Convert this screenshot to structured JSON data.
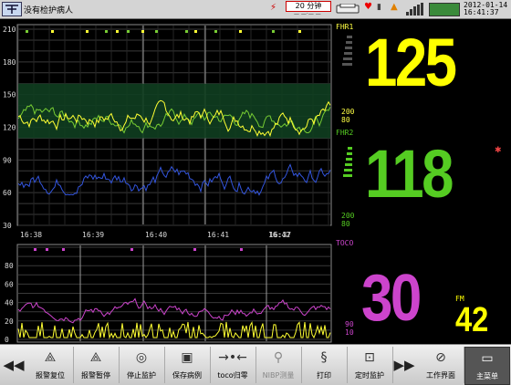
{
  "title_bar": {
    "patient_label": "没有检护病人",
    "paper_speed": "20 分钟",
    "paper_speed_sub": "— —·— —",
    "date": "2012-01-14",
    "time": "16:41:37"
  },
  "fhr_chart": {
    "y_ticks": [
      "210",
      "180",
      "150",
      "120",
      "90",
      "60",
      "30"
    ],
    "time_labels": [
      "16:38",
      "16:39",
      "16:40",
      "16:41",
      "16:42",
      "16:37"
    ]
  },
  "toco_chart": {
    "y_ticks": [
      "80",
      "60",
      "40",
      "20",
      "0"
    ]
  },
  "fhr1": {
    "label": "FHR1",
    "value": "125",
    "upper_limit": "200",
    "lower_limit": "80",
    "color": "#ffff00"
  },
  "fhr2": {
    "label": "FHR2",
    "value": "118",
    "upper_limit": "200",
    "lower_limit": "80",
    "color": "#55cc22"
  },
  "toco": {
    "label": "TOCO",
    "value": "30",
    "upper_limit": "90",
    "lower_limit": "10",
    "color": "#cc44cc"
  },
  "fm": {
    "label": "FM",
    "value": "42",
    "color": "#ffff00"
  },
  "toolbar": {
    "buttons": [
      {
        "label": "报警复位",
        "icon": "alarm-reset-icon"
      },
      {
        "label": "报警暂停",
        "icon": "alarm-pause-icon"
      },
      {
        "label": "停止监护",
        "icon": "stop-monitor-icon"
      },
      {
        "label": "保存病例",
        "icon": "save-case-icon"
      },
      {
        "label": "toco归零",
        "icon": "toco-zero-icon"
      },
      {
        "label": "NIBP测量",
        "icon": "nibp-icon"
      },
      {
        "label": "打印",
        "icon": "print-icon"
      },
      {
        "label": "定时监护",
        "icon": "timer-monitor-icon"
      },
      {
        "label": "工作界面",
        "icon": "work-view-icon"
      },
      {
        "label": "主菜单",
        "icon": "main-menu-icon"
      }
    ]
  },
  "colors": {
    "grid": "#7a7a7a",
    "fhr1_trace": "#ffff33",
    "fhr2_trace": "#77cc33",
    "fetal_move_trace": "#3355dd",
    "toco_trace": "#cc44cc",
    "band": "#0e3a1c"
  }
}
